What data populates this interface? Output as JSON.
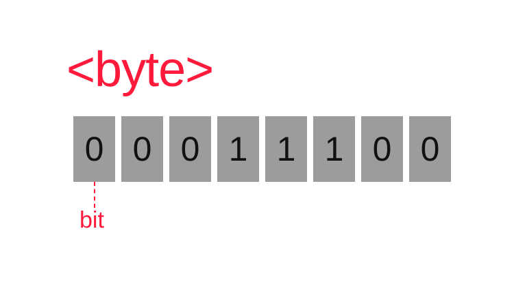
{
  "title": "<byte>",
  "bits": [
    "0",
    "0",
    "0",
    "1",
    "1",
    "1",
    "0",
    "0"
  ],
  "bit_label": "bit",
  "colors": {
    "accent": "#ff1a3c",
    "cell_background": "#9c9c9c",
    "digit": "#111111"
  }
}
